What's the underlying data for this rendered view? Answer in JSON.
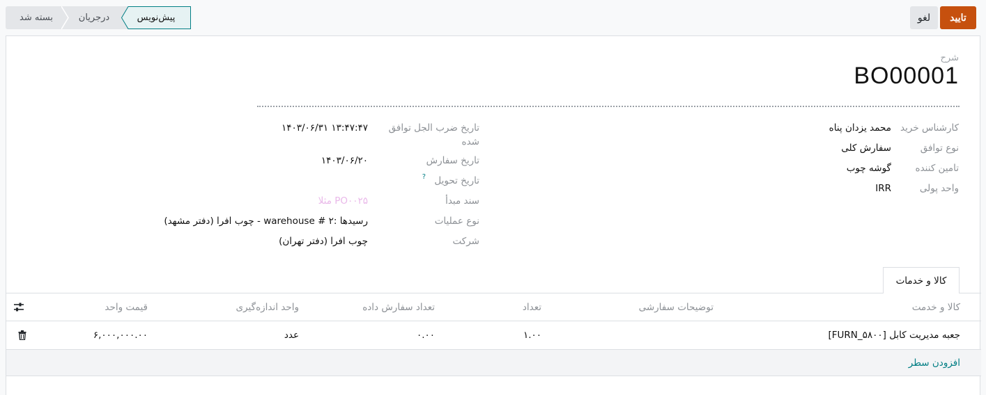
{
  "buttons": {
    "confirm": "تایید",
    "cancel": "لغو"
  },
  "stages": {
    "draft": "پیش‌نویس",
    "in_progress": "درجریان",
    "closed": "بسته شد"
  },
  "header": {
    "label": "شرح",
    "reference": "BO00001"
  },
  "right_fields": [
    {
      "label": "کارشناس خرید",
      "value": "محمد یزدان پناه"
    },
    {
      "label": "نوع توافق",
      "value": "سفارش کلی"
    },
    {
      "label": "تامین کننده",
      "value": "گوشه چوب"
    },
    {
      "label": "واحد پولی",
      "value": "IRR"
    }
  ],
  "left_fields": {
    "deadline_label_1": "تاریخ ضرب الجل توافق",
    "deadline_label_2": "شده",
    "deadline_value": "۱۴۰۳/۰۶/۳۱ ۱۳:۴۷:۴۷",
    "order_date_label": "تاریخ سفارش",
    "order_date_value": "۱۴۰۳/۰۶/۲۰",
    "delivery_label": "تاریخ تحویل",
    "delivery_help": "?",
    "source_label": "سند مبدأ",
    "source_placeholder": "مثلا PO۰۰۲۵",
    "operation_label": "نوع عملیات",
    "operation_value": "چوب افرا (دفتر مشهد) - warehouse # ۲: رسیدها",
    "company_label": "شرکت",
    "company_value": "چوب افرا (دفتر تهران)"
  },
  "tab": {
    "label": "کالا و خدمات"
  },
  "table": {
    "columns": {
      "product": "کالا و خدمت",
      "description": "توضیحات سفارشی",
      "quantity": "تعداد",
      "ordered": "تعداد سفارش داده",
      "uom": "واحد اندازه‌گیری",
      "price": "قیمت واحد"
    },
    "row": {
      "product": "[FURN_۵۸۰۰] جعبه مدیریت کابل",
      "quantity": "۱.۰۰",
      "ordered": "۰.۰۰",
      "uom": "عدد",
      "price": "۶,۰۰۰,۰۰۰.۰۰"
    },
    "add_line": "افزودن سطر"
  },
  "colors": {
    "accent": "#c6500e",
    "link": "#017e84",
    "stage_active": "#e6f2f3"
  },
  "icons": {
    "settings": "sliders-icon",
    "delete": "trash-icon"
  }
}
